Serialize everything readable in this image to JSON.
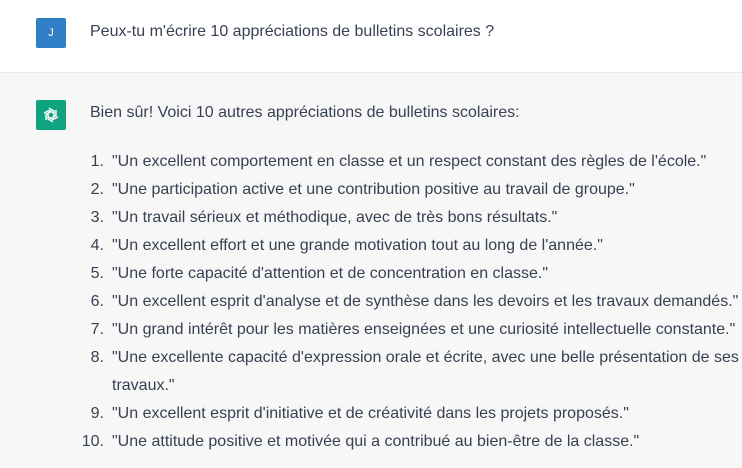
{
  "user": {
    "avatar_initial": "J",
    "avatar_color": "#2f80c6",
    "message": "Peux-tu m'écrire 10 appréciations de bulletins scolaires ?"
  },
  "assistant": {
    "avatar_icon": "openai-logo-icon",
    "avatar_color": "#10a37f",
    "background": "#f7f7f8",
    "intro": "Bien sûr! Voici 10 autres appréciations de bulletins scolaires:",
    "items": [
      {
        "num": "1.",
        "text": "\"Un excellent comportement en classe et un respect constant des règles de l'école.\""
      },
      {
        "num": "2.",
        "text": "\"Une participation active et une contribution positive au travail de groupe.\""
      },
      {
        "num": "3.",
        "text": "\"Un travail sérieux et méthodique, avec de très bons résultats.\""
      },
      {
        "num": "4.",
        "text": "\"Un excellent effort et une grande motivation tout au long de l'année.\""
      },
      {
        "num": "5.",
        "text": "\"Une forte capacité d'attention et de concentration en classe.\""
      },
      {
        "num": "6.",
        "text": "\"Un excellent esprit d'analyse et de synthèse dans les devoirs et les travaux demandés.\""
      },
      {
        "num": "7.",
        "text": "\"Un grand intérêt pour les matières enseignées et une curiosité intellectuelle constante.\""
      },
      {
        "num": "8.",
        "text": "\"Une excellente capacité d'expression orale et écrite, avec une belle présentation de ses travaux.\""
      },
      {
        "num": "9.",
        "text": "\"Un excellent esprit d'initiative et de créativité dans les projets proposés.\""
      },
      {
        "num": "10.",
        "text": "\"Une attitude positive et motivée qui a contribué au bien-être de la classe.\""
      }
    ]
  }
}
